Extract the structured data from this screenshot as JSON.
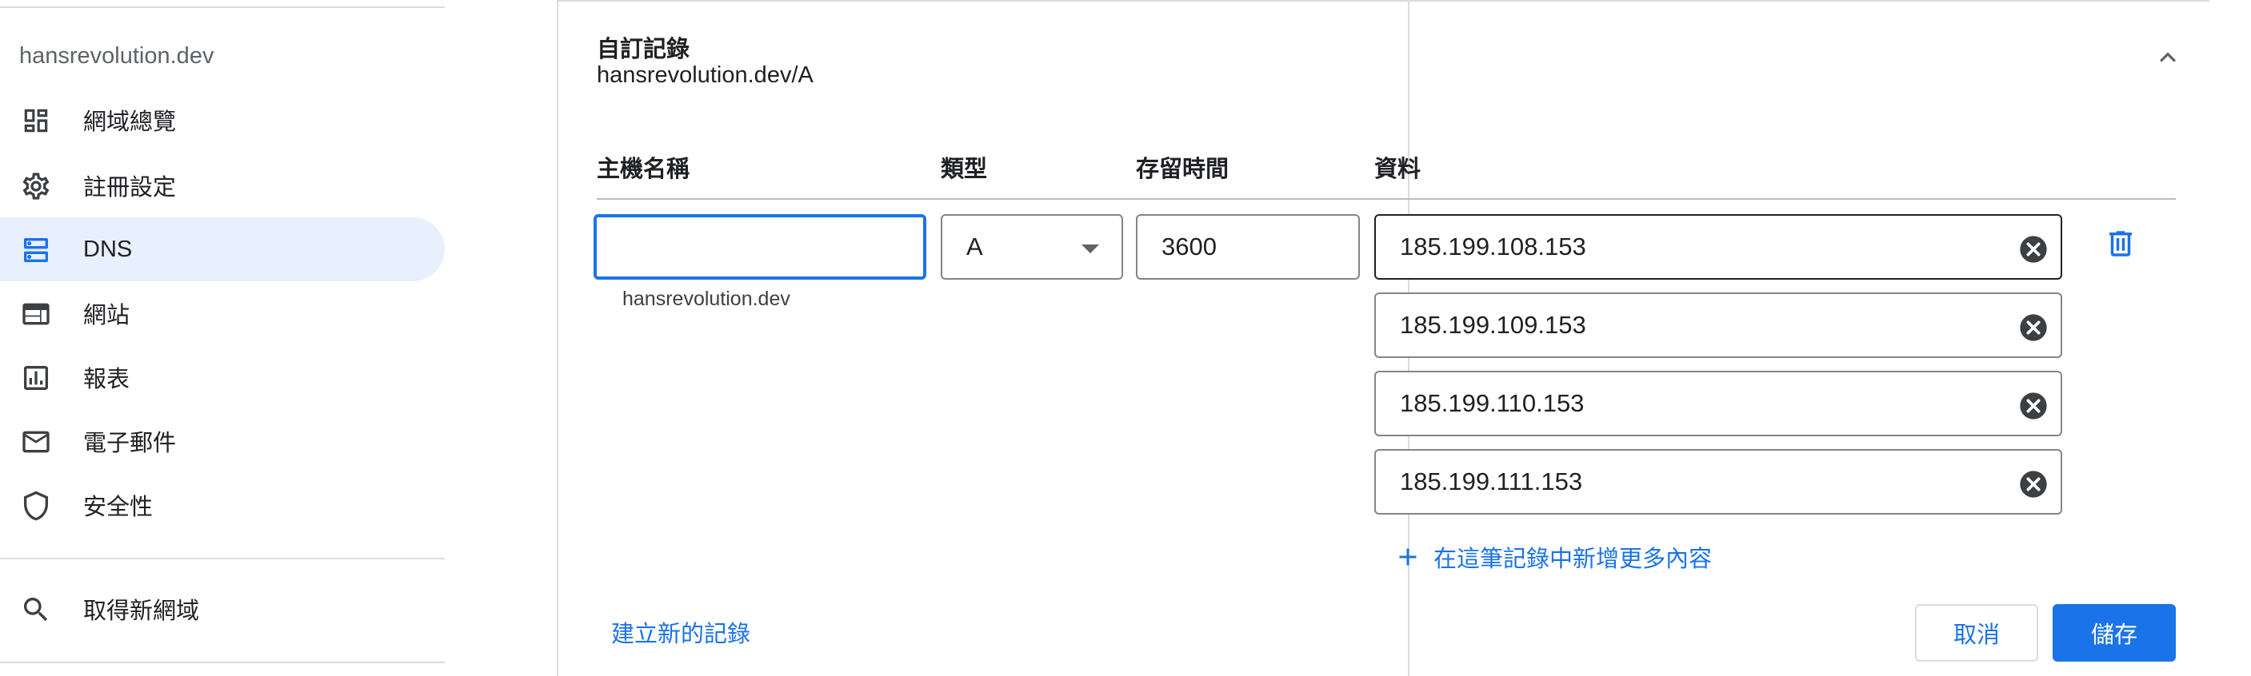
{
  "sidebar": {
    "domain": "hansrevolution.dev",
    "items": [
      {
        "label": "網域總覽",
        "icon": "dashboard-icon",
        "active": false
      },
      {
        "label": "註冊設定",
        "icon": "gear-icon",
        "active": false
      },
      {
        "label": "DNS",
        "icon": "dns-icon",
        "active": true
      },
      {
        "label": "網站",
        "icon": "website-icon",
        "active": false
      },
      {
        "label": "報表",
        "icon": "report-icon",
        "active": false
      },
      {
        "label": "電子郵件",
        "icon": "email-icon",
        "active": false
      },
      {
        "label": "安全性",
        "icon": "shield-icon",
        "active": false
      }
    ],
    "get_domain": {
      "label": "取得新網域",
      "icon": "search-icon"
    }
  },
  "card": {
    "title": "自訂記錄",
    "subtitle": "hansrevolution.dev/A",
    "columns": {
      "host": "主機名稱",
      "type": "類型",
      "ttl": "存留時間",
      "data": "資料"
    },
    "host_value": "",
    "host_hint": "hansrevolution.dev",
    "type_value": "A",
    "ttl_value": "3600",
    "data_values": [
      "185.199.108.153",
      "185.199.109.153",
      "185.199.110.153",
      "185.199.111.153"
    ],
    "add_more_label": "在這筆記錄中新增更多內容",
    "new_record_label": "建立新的記錄",
    "cancel_label": "取消",
    "save_label": "儲存"
  },
  "colors": {
    "accent": "#1a73e8",
    "active_nav_bg": "#e8f0fe",
    "divider": "#dadce0"
  }
}
